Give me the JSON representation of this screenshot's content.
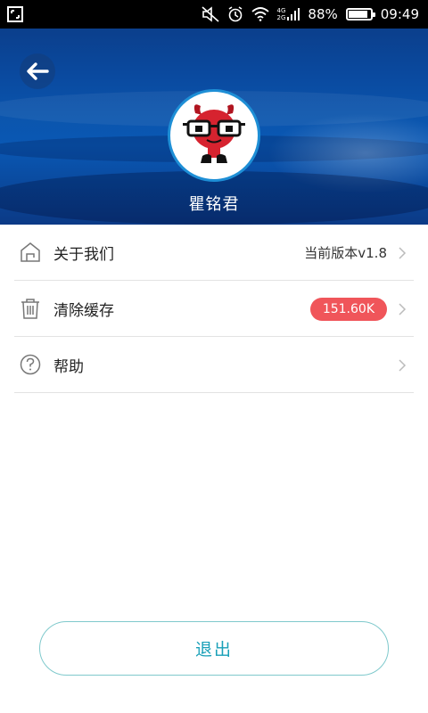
{
  "status_bar": {
    "battery_percent": "88%",
    "time": "09:49",
    "network_top": "4G",
    "network_bottom": "2G",
    "battery_level": 0.88
  },
  "header": {
    "username": "瞿铭君"
  },
  "menu": [
    {
      "label": "关于我们",
      "value": "当前版本v1.8",
      "icon": "home-icon"
    },
    {
      "label": "清除缓存",
      "badge": "151.60K",
      "icon": "trash-icon"
    },
    {
      "label": "帮助",
      "icon": "help-icon"
    }
  ],
  "logout": {
    "label": "退出"
  },
  "colors": {
    "badge": "#f0555a",
    "accent": "#1aa0b8",
    "header_blue": "#0a4aa0"
  }
}
